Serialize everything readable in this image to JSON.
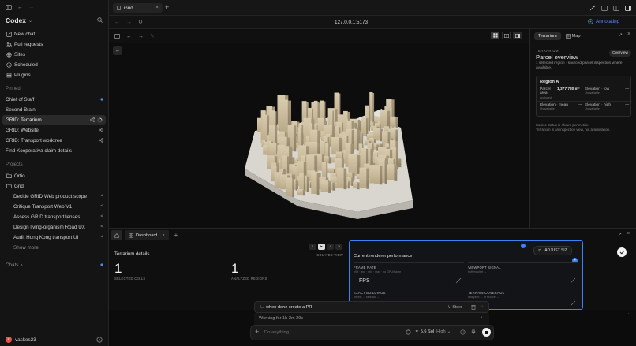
{
  "sidebar": {
    "app_name": "Codex",
    "nav": [
      {
        "label": "New chat",
        "icon": "pencil-icon"
      },
      {
        "label": "Pull requests",
        "icon": "pull-request-icon"
      },
      {
        "label": "Sites",
        "icon": "globe-icon"
      },
      {
        "label": "Scheduled",
        "icon": "clock-icon"
      },
      {
        "label": "Plugins",
        "icon": "plug-icon"
      }
    ],
    "pinned_label": "Pinned",
    "pinned": [
      {
        "label": "Chief of Staff"
      },
      {
        "label": "Second Brain"
      },
      {
        "label": "GRID: Terrarium"
      },
      {
        "label": "GRID: Website"
      },
      {
        "label": "GRID: Transport worktree"
      },
      {
        "label": "Find Kooperativa claim details"
      }
    ],
    "projects_label": "Projects",
    "projects": [
      {
        "label": "Ortio"
      },
      {
        "label": "Grid"
      }
    ],
    "grid_items": [
      {
        "label": "Decide GRID Web product scope"
      },
      {
        "label": "Critique Transport Web V1"
      },
      {
        "label": "Assess GRID transport lenses"
      },
      {
        "label": "Design living-organism Road UX"
      },
      {
        "label": "Audit Hong Kong transport UI"
      }
    ],
    "show_more": "Show more",
    "chats_label": "Chats",
    "user": {
      "initials": "v",
      "name": "vaskes23"
    }
  },
  "tab": {
    "title": "Grid"
  },
  "url": "127.0.0.1:5173",
  "annotating_label": "Annotating",
  "right_panel": {
    "tabs": [
      "Terrarium",
      "Map"
    ],
    "eyebrow": "TERRARIUM",
    "title": "Parcel overview",
    "overview_btn": "Overview",
    "subtitle": "1 selected region · sourced parcel inspection where available.",
    "region_title": "Region A",
    "fields": [
      {
        "label": "Parcel area",
        "sub": "Analyzed",
        "value": "1,377,780 m²"
      },
      {
        "label": "Elevation · low",
        "sub": "Unavailable",
        "value": "—"
      },
      {
        "label": "Elevation · mean",
        "sub": "Unavailable",
        "value": "—"
      },
      {
        "label": "Elevation · high",
        "sub": "Unavailable",
        "value": "—"
      }
    ],
    "note1": "Source status is shown per metric.",
    "note2": "Terrarium is an inspection view, not a simulation."
  },
  "dock": {
    "tab": "Dashboard",
    "isolated_label": "ISOLATED VIEW",
    "terrarium_title": "Terrarium details",
    "stats": [
      {
        "value": "1",
        "label": "SELECTED CELLS"
      },
      {
        "value": "1",
        "label": "ANALYZED REGIONS"
      }
    ],
    "perf_title": "Current renderer performance",
    "adjust_label": "ADJUST SIZ",
    "metrics": [
      {
        "title": "FRAME RATE",
        "sub": "p95 · avg · min · max · no GPU/frame",
        "value": "—FPS"
      },
      {
        "title": "VIEWPORT SIGNAL",
        "sub": "buffers pixel →",
        "value": "—"
      },
      {
        "title": "EXACT BUILDINGS",
        "sub": "offsets → fallback →",
        "value": ""
      },
      {
        "title": "TERRAIN COVERAGE",
        "sub": "analyzed → of source →",
        "value": ""
      }
    ]
  },
  "composer": {
    "queued": "when done create a PR",
    "steer": "Steer",
    "working": "Working for 1h 2m 29s",
    "placeholder": "Do anything",
    "model": "5.6 Sol",
    "effort": "High"
  }
}
